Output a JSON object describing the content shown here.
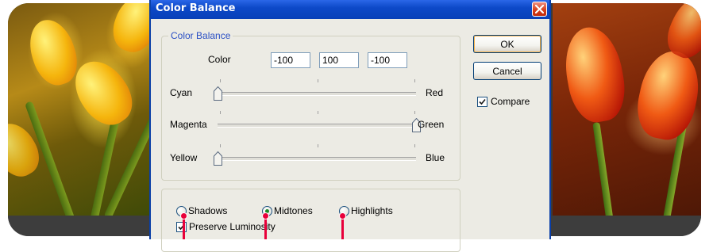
{
  "dialog": {
    "title": "Color Balance",
    "group_label": "Color Balance",
    "color_label": "Color",
    "levels": [
      "-100",
      "100",
      "-100"
    ],
    "sliders": [
      {
        "left_label": "Cyan",
        "right_label": "Red",
        "value": -100
      },
      {
        "left_label": "Magenta",
        "right_label": "Green",
        "value": 100
      },
      {
        "left_label": "Yellow",
        "right_label": "Blue",
        "value": -100
      }
    ],
    "ok_label": "OK",
    "cancel_label": "Cancel",
    "compare_label": "Compare",
    "compare_checked": true,
    "tone_options": [
      {
        "label": "Shadows",
        "selected": false
      },
      {
        "label": "Midtones",
        "selected": true
      },
      {
        "label": "Highlights",
        "selected": false
      }
    ],
    "preserve_label": "Preserve Luminosity",
    "preserve_checked": true
  },
  "colors": {
    "accent_title": "#0840b8",
    "close_button": "#d8401c",
    "pointer": "#e8003a",
    "group_legend": "#2a4fc4"
  }
}
